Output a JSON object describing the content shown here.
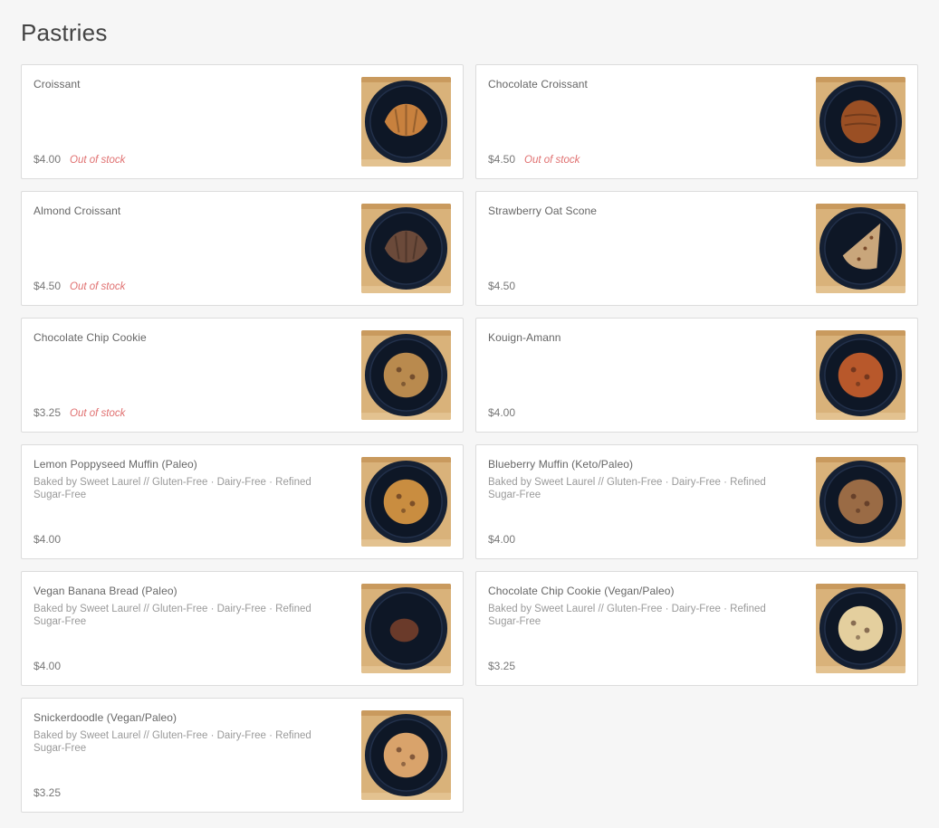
{
  "section": {
    "title": "Pastries"
  },
  "items": [
    {
      "name": "Croissant",
      "description": "",
      "price": "$4.00",
      "status": "Out of stock",
      "food_color": "#c8813e",
      "food_shape": "croissant"
    },
    {
      "name": "Chocolate Croissant",
      "description": "",
      "price": "$4.50",
      "status": "Out of stock",
      "food_color": "#9a4f24",
      "food_shape": "oval"
    },
    {
      "name": "Almond Croissant",
      "description": "",
      "price": "$4.50",
      "status": "Out of stock",
      "food_color": "#6b4a3a",
      "food_shape": "croissant"
    },
    {
      "name": "Strawberry Oat Scone",
      "description": "",
      "price": "$4.50",
      "status": "",
      "food_color": "#c9a67b",
      "food_shape": "triangle"
    },
    {
      "name": "Chocolate Chip Cookie",
      "description": "",
      "price": "$3.25",
      "status": "Out of stock",
      "food_color": "#b98a4e",
      "food_shape": "round"
    },
    {
      "name": "Kouign-Amann",
      "description": "",
      "price": "$4.00",
      "status": "",
      "food_color": "#b8582b",
      "food_shape": "round"
    },
    {
      "name": "Lemon Poppyseed Muffin (Paleo)",
      "description": "Baked by Sweet Laurel // Gluten-Free · Dairy-Free · Refined Sugar-Free",
      "price": "$4.00",
      "status": "",
      "food_color": "#c98d40",
      "food_shape": "round"
    },
    {
      "name": "Blueberry Muffin (Keto/Paleo)",
      "description": "Baked by Sweet Laurel // Gluten-Free · Dairy-Free · Refined Sugar-Free",
      "price": "$4.00",
      "status": "",
      "food_color": "#9a6b45",
      "food_shape": "round"
    },
    {
      "name": "Vegan Banana Bread (Paleo)",
      "description": "Baked by Sweet Laurel // Gluten-Free · Dairy-Free · Refined Sugar-Free",
      "price": "$4.00",
      "status": "",
      "food_color": "#6a3a2a",
      "food_shape": "small"
    },
    {
      "name": "Chocolate Chip Cookie (Vegan/Paleo)",
      "description": "Baked by Sweet Laurel // Gluten-Free · Dairy-Free · Refined Sugar-Free",
      "price": "$3.25",
      "status": "",
      "food_color": "#e4cf9e",
      "food_shape": "round"
    },
    {
      "name": "Snickerdoodle (Vegan/Paleo)",
      "description": "Baked by Sweet Laurel // Gluten-Free · Dairy-Free · Refined Sugar-Free",
      "price": "$3.25",
      "status": "",
      "food_color": "#d9a36b",
      "food_shape": "round"
    }
  ]
}
